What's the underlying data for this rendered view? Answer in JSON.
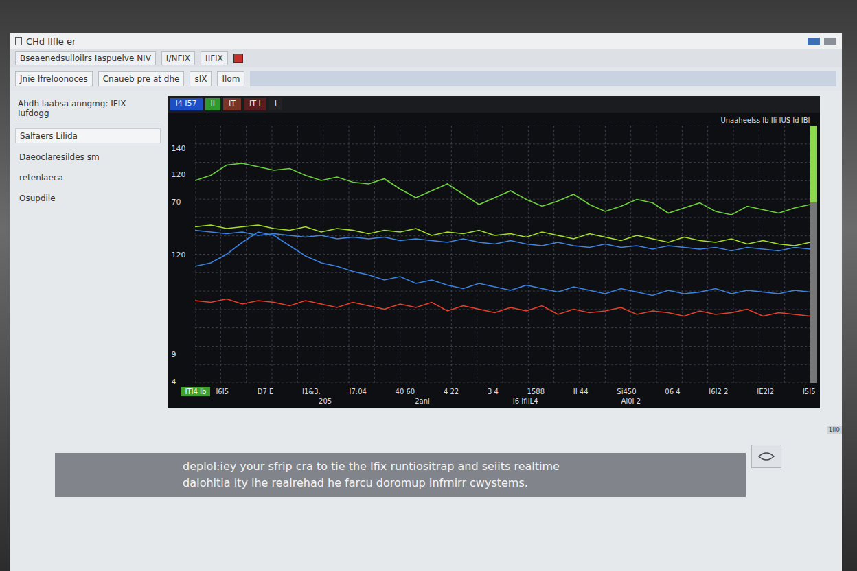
{
  "window": {
    "title": "CHd Ilfle er"
  },
  "toolbar": [
    {
      "label": "Bseaenedsulloilrs Iaspuelve NIV"
    },
    {
      "label": "I/NFIX"
    },
    {
      "label": "IIFIX"
    }
  ],
  "toolbar2": [
    {
      "label": "Jnie Ifreloonoces"
    },
    {
      "label": "Cnaueb pre at dhe"
    },
    {
      "label": "sIX"
    },
    {
      "label": "Ilom"
    }
  ],
  "sidebar": {
    "heading": "Ahdh laabsa anngmg: IFIX Iufdogg",
    "items": [
      {
        "label": "Salfaers Lilida",
        "selected": true
      },
      {
        "label": "Daeoclaresildes  sm",
        "selected": false
      },
      {
        "label": "retenlaeca",
        "selected": false
      },
      {
        "label": "Osupdile",
        "selected": false
      }
    ]
  },
  "chart": {
    "strip": [
      {
        "label": "I4 I57",
        "color": "#1d4fc4"
      },
      {
        "label": "II",
        "color": "#2f9b2f"
      },
      {
        "label": "IT",
        "color": "#7a3426"
      },
      {
        "label": "IT I",
        "color": "#5a1e1e"
      },
      {
        "label": "I",
        "color": "#222222"
      }
    ],
    "corner": "Unaaheelss  Ib  Ili  IUS  Id IBI",
    "y_ticks": [
      {
        "label": "140",
        "at": 136
      },
      {
        "label": "120",
        "at": 121
      },
      {
        "label": "70",
        "at": 105
      },
      {
        "label": "120",
        "at": 74
      },
      {
        "label": "9",
        "at": 16
      },
      {
        "label": "4",
        "at": 0
      }
    ],
    "x_labels": [
      "I6I5",
      "D7 E",
      "I1&3.",
      "I7:04",
      "40 60",
      "4 22",
      "3 4",
      "1588",
      "II 44",
      "Si450",
      "06 4",
      "I6I2 2",
      "IE2I2",
      "I5I5"
    ],
    "x_labels2": [
      "205",
      "2ani",
      "I6 IfIIL4",
      "Ai0I 2"
    ],
    "legend": "ITI4 Ib",
    "series": [
      {
        "color": "#6fd13a",
        "values": [
          118,
          121,
          127,
          128,
          126,
          124,
          125,
          121,
          118,
          120,
          117,
          116,
          119,
          113,
          108,
          112,
          116,
          110,
          104,
          108,
          112,
          107,
          103,
          106,
          110,
          104,
          100,
          103,
          107,
          105,
          99,
          102,
          105,
          100,
          98,
          103,
          101,
          99,
          102,
          104
        ]
      },
      {
        "color": "#3f86e0",
        "values": [
          89,
          88,
          87,
          88,
          86,
          87,
          86,
          85,
          86,
          84,
          85,
          84,
          85,
          83,
          84,
          83,
          82,
          84,
          82,
          81,
          83,
          81,
          80,
          82,
          80,
          79,
          81,
          79,
          80,
          78,
          80,
          79,
          78,
          79,
          77,
          79,
          78,
          77,
          79,
          78
        ]
      },
      {
        "color": "#a6e02a",
        "values": [
          91,
          92,
          90,
          91,
          92,
          90,
          89,
          91,
          88,
          90,
          89,
          87,
          89,
          88,
          90,
          86,
          88,
          87,
          89,
          86,
          87,
          85,
          88,
          86,
          84,
          87,
          85,
          83,
          86,
          84,
          82,
          85,
          83,
          82,
          84,
          81,
          83,
          81,
          80,
          82
        ]
      },
      {
        "color": "#3a82e4",
        "values": [
          68,
          70,
          75,
          82,
          88,
          86,
          80,
          74,
          70,
          68,
          65,
          63,
          60,
          62,
          58,
          60,
          57,
          55,
          58,
          56,
          54,
          57,
          55,
          53,
          56,
          54,
          52,
          55,
          53,
          51,
          54,
          52,
          53,
          55,
          52,
          54,
          53,
          52,
          54,
          53
        ]
      },
      {
        "color": "#e8402a",
        "values": [
          48,
          47,
          49,
          46,
          48,
          47,
          45,
          48,
          46,
          44,
          47,
          45,
          43,
          46,
          44,
          47,
          42,
          45,
          43,
          41,
          44,
          42,
          45,
          40,
          43,
          41,
          42,
          44,
          40,
          42,
          41,
          39,
          42,
          40,
          41,
          43,
          39,
          41,
          40,
          39
        ]
      }
    ]
  },
  "caption": {
    "lines": [
      "deploI:iey your sfrip cra to tie the Ifix runtiositrap and seiits  realtime",
      "daIohitia ity ihe realrehad he farcu doromup Infrnirr cwystems."
    ]
  },
  "corner_tag": "1ll0"
}
